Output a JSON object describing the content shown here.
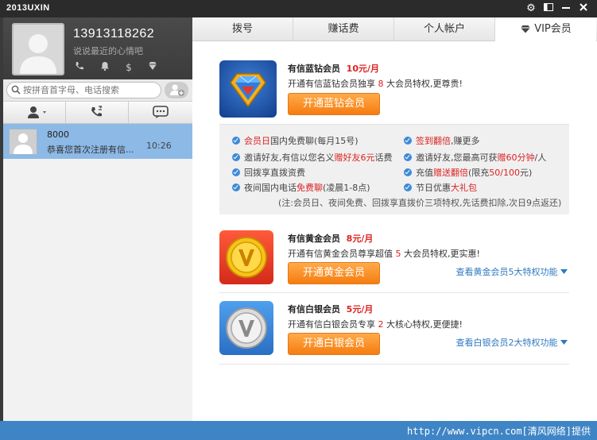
{
  "app": {
    "title": "2013UXIN"
  },
  "profile": {
    "phone": "13913118262",
    "mood": "说说最近的心情吧"
  },
  "search": {
    "placeholder": "按拼音首字母、电话搜索"
  },
  "contacts": [
    {
      "name": "8000",
      "message": "恭喜您首次注册有信...",
      "time": "10:26"
    }
  ],
  "nav": {
    "tabs": [
      "拨号",
      "赚话费",
      "个人帐户",
      "VIP会员"
    ]
  },
  "vip": {
    "blue": {
      "name": "有信蓝钻会员",
      "price": "10元/月",
      "desc_pre": "开通有信蓝钻会员独享",
      "desc_num": "8",
      "desc_post": "大会员特权,更尊贵!",
      "button": "开通蓝钻会员"
    },
    "gold": {
      "name": "有信黄金会员",
      "price": "8元/月",
      "desc_pre": "开通有信黄金会员尊享超值",
      "desc_num": "5",
      "desc_post": "大会员特权,更实惠!",
      "button": "开通黄金会员",
      "link": "查看黄金会员5大特权功能"
    },
    "silver": {
      "name": "有信白银会员",
      "price": "5元/月",
      "desc_pre": "开通有信白银会员专享",
      "desc_num": "2",
      "desc_post": "大核心特权,更便捷!",
      "button": "开通白银会员",
      "link": "查看白银会员2大特权功能"
    }
  },
  "perks": {
    "p1a": "会员日",
    "p1b": "国内免费聊(每月15号)",
    "p2a": "签到翻倍",
    "p2b": ",赚更多",
    "p3a": "邀请好友,有信以您名义",
    "p3b": "赠好友6元",
    "p3c": "话费",
    "p4a": "邀请好友,您最高可获",
    "p4b": "赠60分钟",
    "p4c": "/人",
    "p5": "回拨享直拨资费",
    "p6a": "充值",
    "p6b": "赠送翻倍",
    "p6c": "(限充",
    "p6d": "50/100",
    "p6e": "元)",
    "p7a": "夜间国内电话",
    "p7b": "免费聊",
    "p7c": "(凌晨1-8点)",
    "p8a": "节日优惠",
    "p8b": "大礼包",
    "note": "(注:会员日、夜间免费、回拨享直拨价三项特权,先话费扣除,次日9点返还)"
  },
  "footer": {
    "watermark": "http://www.vipcn.com[清风网络]提供"
  },
  "colors": {
    "accent_blue": "#3f85c5",
    "orange": "#f57d10",
    "red": "#dd2222",
    "selected_contact": "#8db9e6"
  }
}
